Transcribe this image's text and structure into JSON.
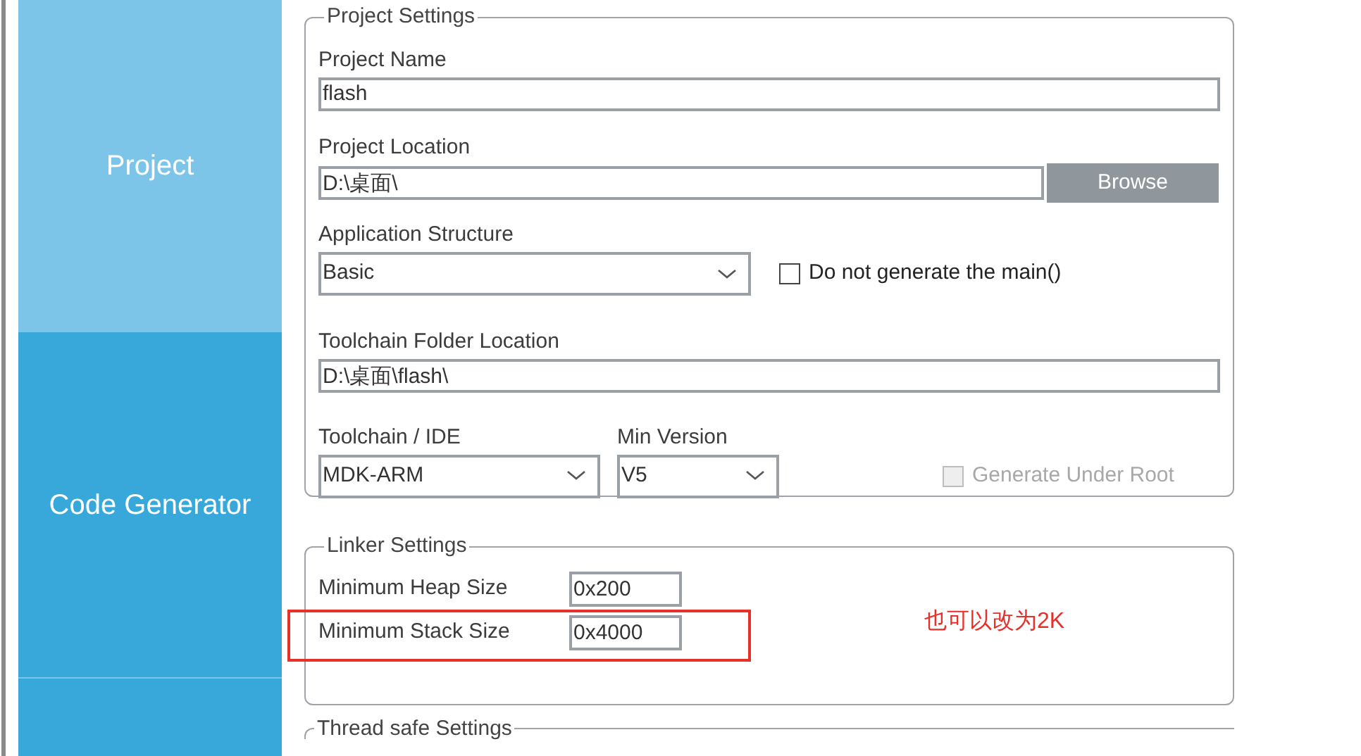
{
  "sidebar": {
    "items": [
      {
        "label": "Project",
        "selected": true
      },
      {
        "label": "Code Generator",
        "selected": false
      },
      {
        "selected": false
      }
    ]
  },
  "project_settings": {
    "title": "Project Settings",
    "project_name": {
      "label": "Project Name",
      "value": "flash"
    },
    "project_location": {
      "label": "Project Location",
      "value": "D:\\桌面\\",
      "button": "Browse"
    },
    "application_structure": {
      "label": "Application Structure",
      "value": "Basic",
      "checkbox": {
        "label": "Do not generate the main()",
        "checked": false
      }
    },
    "toolchain_folder": {
      "label": "Toolchain Folder Location",
      "value": "D:\\桌面\\flash\\"
    },
    "toolchain_ide": {
      "label": "Toolchain / IDE",
      "value": "MDK-ARM"
    },
    "min_version": {
      "label": "Min Version",
      "value": "V5"
    },
    "generate_under_root": {
      "label": "Generate Under Root",
      "checked": false,
      "disabled": true
    }
  },
  "linker_settings": {
    "title": "Linker Settings",
    "fields": [
      {
        "label": "Minimum Heap Size",
        "value": "0x200",
        "highlighted": false
      },
      {
        "label": "Minimum Stack Size",
        "value": "0x4000",
        "highlighted": true
      }
    ],
    "annotation": "也可以改为2K"
  },
  "thread_safe_settings": {
    "title": "Thread safe Settings"
  }
}
